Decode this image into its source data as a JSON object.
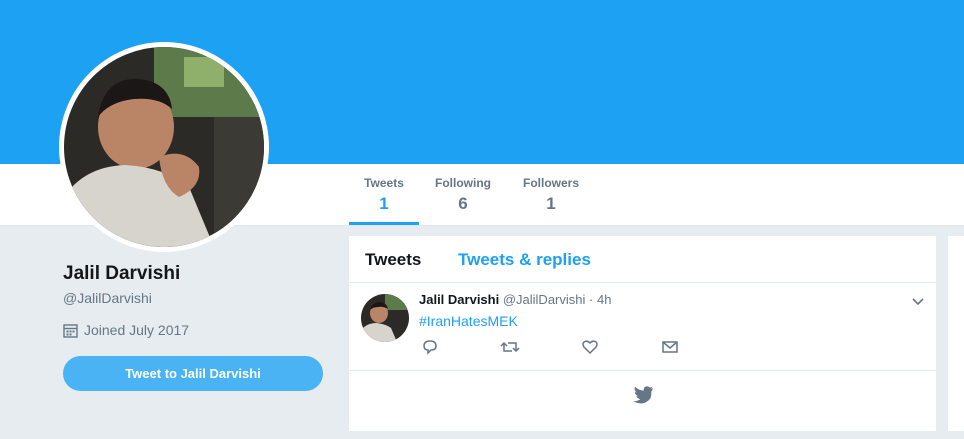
{
  "profile": {
    "name": "Jalil Darvishi",
    "handle": "@JalilDarvishi",
    "joined": "Joined July 2017",
    "tweet_to_label": "Tweet to Jalil Darvishi"
  },
  "stats": [
    {
      "label": "Tweets",
      "value": "1"
    },
    {
      "label": "Following",
      "value": "6"
    },
    {
      "label": "Followers",
      "value": "1"
    }
  ],
  "timeline": {
    "tabs": [
      "Tweets",
      "Tweets & replies"
    ],
    "tweet": {
      "name": "Jalil Darvishi",
      "handle": "@JalilDarvishi",
      "separator": "·",
      "time": "4h",
      "hashtag": "#IranHatesMEK"
    }
  },
  "icons": [
    "calendar-icon",
    "reply-icon",
    "retweet-icon",
    "like-icon",
    "direct-message-icon",
    "chevron-down-icon",
    "twitter-bird-icon"
  ],
  "colors": {
    "brand": "#1da1f2",
    "button": "#4ab3f4",
    "text": "#14171a",
    "muted": "#657786",
    "background": "#e6ecf0"
  }
}
